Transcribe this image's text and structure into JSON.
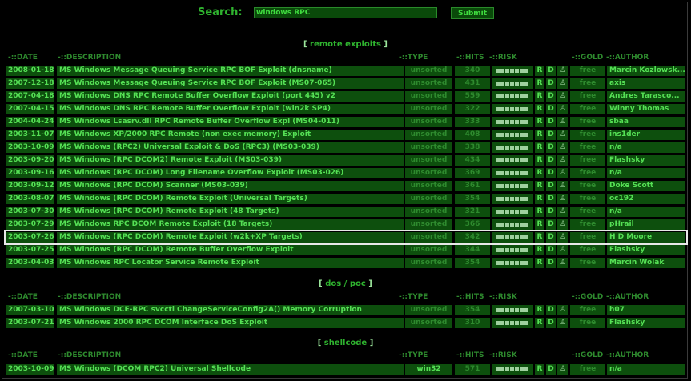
{
  "search": {
    "label": "Search:",
    "value": "windows RPC",
    "submit_label": "Submit"
  },
  "columns": {
    "date": "-::DATE",
    "description": "-::DESCRIPTION",
    "type": "-::TYPE",
    "hits": "-::HITS",
    "risk": "-::RISK",
    "gold": "-::GOLD",
    "author": "-::AUTHOR"
  },
  "row_icons": {
    "r": "R",
    "d": "D",
    "v": "♙"
  },
  "sections": [
    {
      "title": "remote exploits",
      "rows": [
        {
          "date": "2008-01-18",
          "description": "MS Windows Message Queuing Service RPC BOF Exploit (dnsname)",
          "type": "unsorted",
          "hits": "340",
          "gold": "free",
          "author": "Marcin Kozlowsk..."
        },
        {
          "date": "2007-12-18",
          "description": "MS Windows Message Queuing Service RPC BOF Exploit (MS07-065)",
          "type": "unsorted",
          "hits": "431",
          "gold": "free",
          "author": "axis"
        },
        {
          "date": "2007-04-18",
          "description": "MS Windows DNS RPC Remote Buffer Overflow Exploit (port 445) v2",
          "type": "unsorted",
          "hits": "559",
          "gold": "free",
          "author": "Andres Tarasco..."
        },
        {
          "date": "2007-04-15",
          "description": "MS Windows DNS RPC Remote Buffer Overflow Exploit (win2k SP4)",
          "type": "unsorted",
          "hits": "322",
          "gold": "free",
          "author": "Winny Thomas"
        },
        {
          "date": "2004-04-24",
          "description": "MS Windows Lsasrv.dll RPC Remote Buffer Overflow Expl (MS04-011)",
          "type": "unsorted",
          "hits": "333",
          "gold": "free",
          "author": "sbaa"
        },
        {
          "date": "2003-11-07",
          "description": "MS Windows XP/2000 RPC Remote (non exec memory) Exploit",
          "type": "unsorted",
          "hits": "408",
          "gold": "free",
          "author": "ins1der"
        },
        {
          "date": "2003-10-09",
          "description": "MS Windows (RPC2) Universal Exploit & DoS (RPC3) (MS03-039)",
          "type": "unsorted",
          "hits": "338",
          "gold": "free",
          "author": "n/a"
        },
        {
          "date": "2003-09-20",
          "description": "MS Windows (RPC DCOM2) Remote Exploit (MS03-039)",
          "type": "unsorted",
          "hits": "434",
          "gold": "free",
          "author": "Flashsky"
        },
        {
          "date": "2003-09-16",
          "description": "MS Windows (RPC DCOM) Long Filename Overflow Exploit (MS03-026)",
          "type": "unsorted",
          "hits": "369",
          "gold": "free",
          "author": "n/a"
        },
        {
          "date": "2003-09-12",
          "description": "MS Windows (RPC DCOM) Scanner (MS03-039)",
          "type": "unsorted",
          "hits": "361",
          "gold": "free",
          "author": "Doke Scott"
        },
        {
          "date": "2003-08-07",
          "description": "MS Windows (RPC DCOM) Remote Exploit (Universal Targets)",
          "type": "unsorted",
          "hits": "354",
          "gold": "free",
          "author": "oc192"
        },
        {
          "date": "2003-07-30",
          "description": "MS Windows (RPC DCOM) Remote Exploit (48 Targets)",
          "type": "unsorted",
          "hits": "321",
          "gold": "free",
          "author": "n/a"
        },
        {
          "date": "2003-07-29",
          "description": "MS Windows RPC DCOM Remote Exploit (18 Targets)",
          "type": "unsorted",
          "hits": "366",
          "gold": "free",
          "author": "pHrail"
        },
        {
          "date": "2003-07-26",
          "description": "MS Windows (RPC DCOM) Remote Exploit (w2k+XP Targets)",
          "type": "unsorted",
          "hits": "342",
          "gold": "free",
          "author": "H D Moore",
          "selected": true
        },
        {
          "date": "2003-07-25",
          "description": "MS Windows (RPC DCOM) Remote Buffer Overflow Exploit",
          "type": "unsorted",
          "hits": "344",
          "gold": "free",
          "author": "Flashsky"
        },
        {
          "date": "2003-04-03",
          "description": "MS Windows RPC Locator Service Remote Exploit",
          "type": "unsorted",
          "hits": "354",
          "gold": "free",
          "author": "Marcin Wolak"
        }
      ]
    },
    {
      "title": "dos / poc",
      "rows": [
        {
          "date": "2007-03-10",
          "description": "MS Windows DCE-RPC svcctl ChangeServiceConfig2A() Memory Corruption",
          "type": "unsorted",
          "hits": "354",
          "gold": "free",
          "author": "h07"
        },
        {
          "date": "2003-07-21",
          "description": "MS Windows 2000 RPC DCOM Interface DoS Exploit",
          "type": "unsorted",
          "hits": "310",
          "gold": "free",
          "author": "Flashsky"
        }
      ]
    },
    {
      "title": "shellcode",
      "rows": [
        {
          "date": "2003-10-09",
          "description": "MS Windows (DCOM RPC2) Universal Shellcode",
          "type": "win32",
          "hits": "571",
          "gold": "free",
          "author": "n/a"
        }
      ]
    }
  ],
  "colors": {
    "background": "#000000",
    "row": "#0d4f0d",
    "text": "#55e055",
    "muted": "#2e8a2e",
    "selection": "#e8e8e8"
  },
  "icons": {
    "risk": "risk-meter-icon",
    "vote": "pawn-icon"
  }
}
